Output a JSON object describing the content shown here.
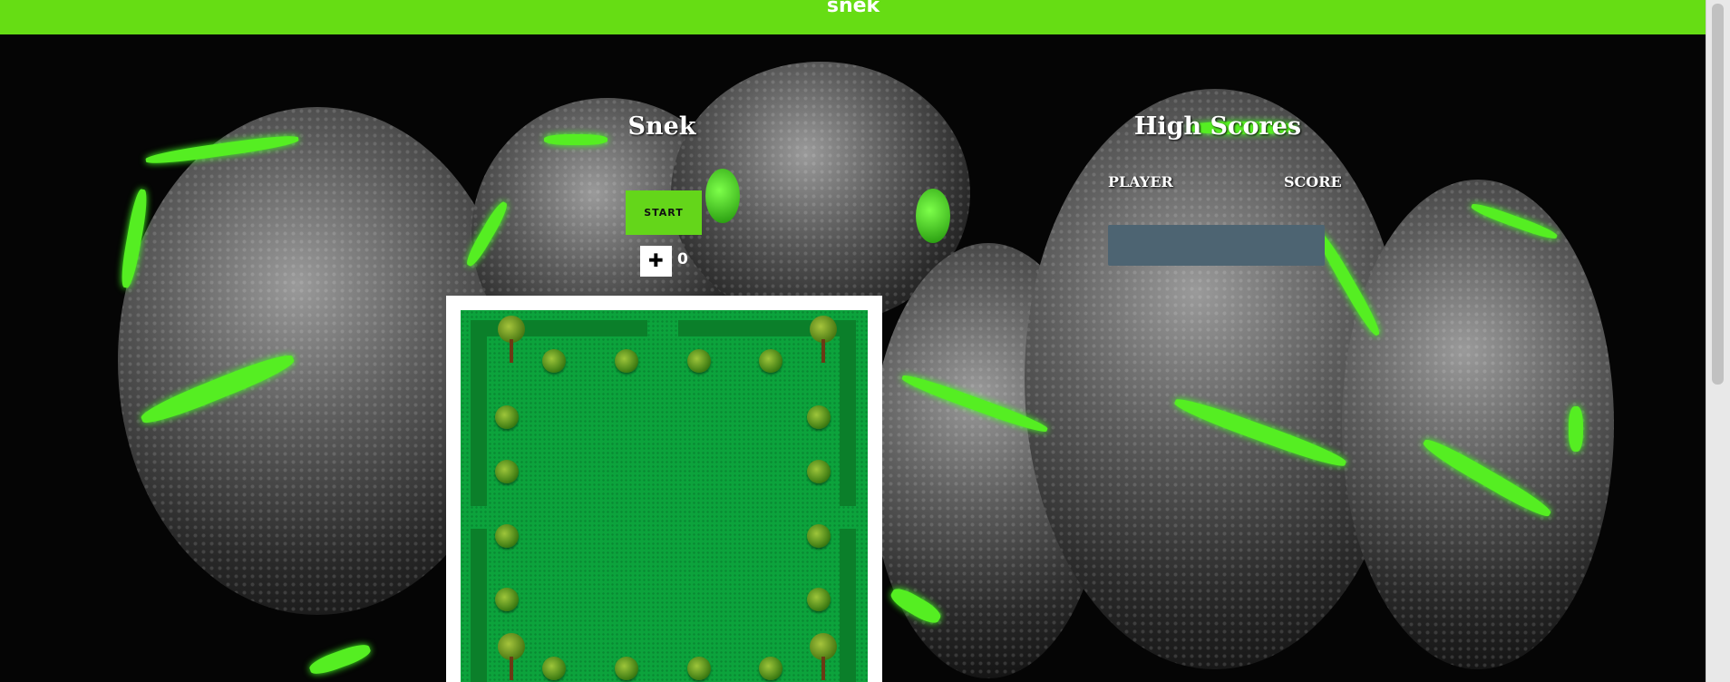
{
  "header": {
    "title": "snek"
  },
  "game": {
    "title": "Snek",
    "start_label": "START",
    "lives_icon": "snake-life-icon",
    "score": "0"
  },
  "high_scores": {
    "title": "High Scores",
    "col_player": "PLAYER",
    "col_score": "SCORE",
    "rows": []
  },
  "colors": {
    "header_bg": "#66dd14",
    "start_bg": "#64d61a",
    "board_grass": "#0ca33c",
    "scores_box": "#4d6472"
  }
}
